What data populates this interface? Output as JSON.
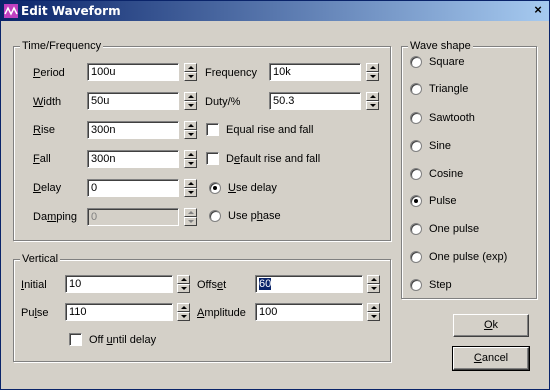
{
  "window": {
    "title": "Edit Waveform",
    "close_glyph": "×"
  },
  "time_frequency": {
    "label": "Time/Frequency",
    "period": {
      "pre": "",
      "u": "P",
      "post": "eriod",
      "value": "100u"
    },
    "width": {
      "pre": "",
      "u": "W",
      "post": "idth",
      "value": "50u"
    },
    "rise": {
      "pre": "",
      "u": "R",
      "post": "ise",
      "value": "300n"
    },
    "fall": {
      "pre": "",
      "u": "F",
      "post": "all",
      "value": "300n"
    },
    "delay": {
      "pre": "",
      "u": "D",
      "post": "elay",
      "value": "0"
    },
    "damping": {
      "pre": "Da",
      "u": "m",
      "post": "ping",
      "value": "0"
    },
    "frequency": {
      "label": "Frequency",
      "value": "10k"
    },
    "duty": {
      "label": "Duty/%",
      "value": "50.3"
    },
    "equal_rise_fall": {
      "label": "Equal rise and fall",
      "checked": false
    },
    "default_rise_fall": {
      "pre": "D",
      "u": "e",
      "post": "fault rise and fall",
      "checked": false
    },
    "use_delay": {
      "pre": "",
      "u": "U",
      "post": "se delay",
      "selected": true
    },
    "use_phase": {
      "pre": "Use p",
      "u": "h",
      "post": "ase",
      "selected": false
    }
  },
  "vertical": {
    "label": "Vertical",
    "initial": {
      "pre": "",
      "u": "I",
      "post": "nitial",
      "value": "10"
    },
    "pulse": {
      "pre": "Pu",
      "u": "l",
      "post": "se",
      "value": "110"
    },
    "offset": {
      "pre": "Offs",
      "u": "e",
      "post": "t",
      "value": "60"
    },
    "amplitude": {
      "pre": "",
      "u": "A",
      "post": "mplitude",
      "value": "100"
    },
    "off_until_delay": {
      "pre": "Off ",
      "u": "u",
      "post": "ntil delay",
      "checked": false
    }
  },
  "wave_shape": {
    "label": "Wave shape",
    "options": [
      {
        "label": "Square",
        "selected": false
      },
      {
        "label": "Triangle",
        "selected": false
      },
      {
        "label": "Sawtooth",
        "selected": false
      },
      {
        "label": "Sine",
        "selected": false
      },
      {
        "label": "Cosine",
        "selected": false
      },
      {
        "label": "Pulse",
        "selected": true
      },
      {
        "label": "One pulse",
        "selected": false
      },
      {
        "label": "One pulse (exp)",
        "selected": false
      },
      {
        "label": "Step",
        "selected": false
      }
    ]
  },
  "buttons": {
    "ok": {
      "pre": "",
      "u": "O",
      "post": "k"
    },
    "cancel": {
      "pre": "",
      "u": "C",
      "post": "ancel"
    }
  },
  "colors": {
    "titlebar_start": "#0a246a",
    "titlebar_end": "#a6caf0",
    "dialog_bg": "#d4d0c8",
    "selection": "#0a246a"
  },
  "icons": {
    "app": "waveform-app-icon",
    "spinner": "spin-arrows-icon"
  }
}
